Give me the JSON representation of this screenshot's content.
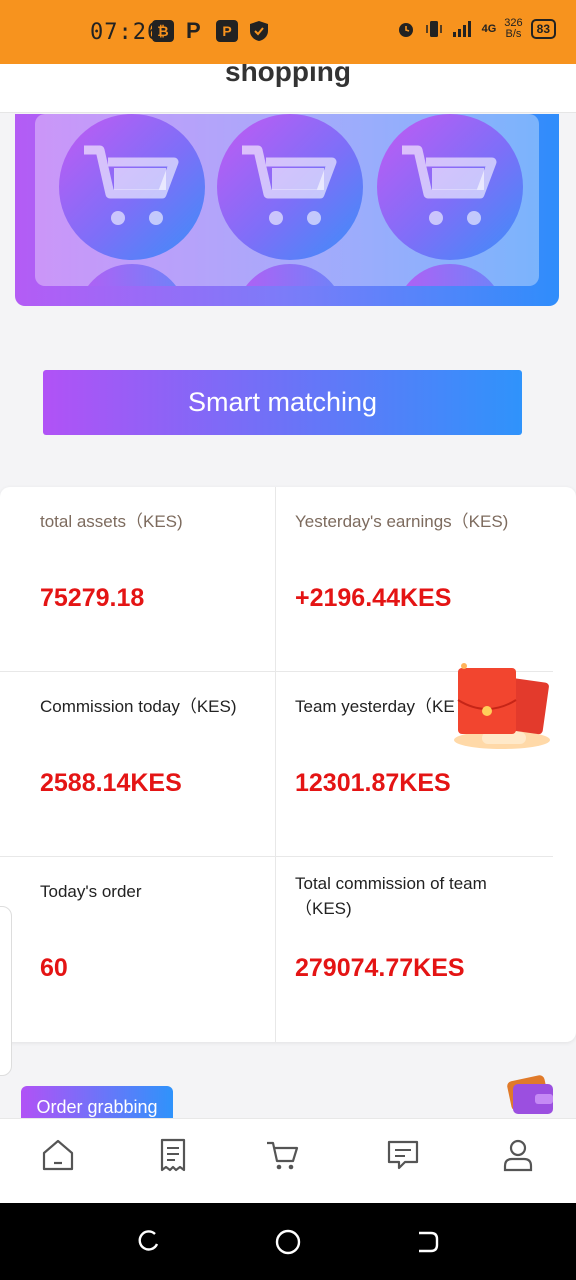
{
  "status_bar": {
    "time": "07:26",
    "network": "4G",
    "speed_value": "326",
    "speed_unit": "B/s",
    "battery": "83"
  },
  "header": {
    "title": "shopping"
  },
  "banner": {
    "slots": [
      "shopping-cart-icon",
      "shopping-cart-icon",
      "shopping-cart-icon"
    ]
  },
  "actions": {
    "smart_matching_label": "Smart matching"
  },
  "stats": {
    "total_assets": {
      "label": "total assets（KES)",
      "value": "75279.18"
    },
    "yesterday_earnings": {
      "label": "Yesterday's earnings（KES)",
      "value": "+2196.44KES"
    },
    "commission_today": {
      "label": "Commission today（KES)",
      "value": "2588.14KES"
    },
    "team_yesterday": {
      "label": "Team yesterday（KE",
      "value": "12301.87KES"
    },
    "todays_order": {
      "label": "Today's order",
      "value": "60"
    },
    "team_commission": {
      "label": "Total commission of team （KES)",
      "value": "279074.77KES"
    }
  },
  "order_grabbing_label": "Order grabbing",
  "bottom_nav": {
    "items": [
      "home-icon",
      "orders-icon",
      "cart-icon",
      "messages-icon",
      "profile-icon"
    ]
  },
  "colors": {
    "status_bar": "#f7931e",
    "accent_start": "#b152f6",
    "accent_end": "#2f93fb",
    "value_red": "#e41414"
  }
}
